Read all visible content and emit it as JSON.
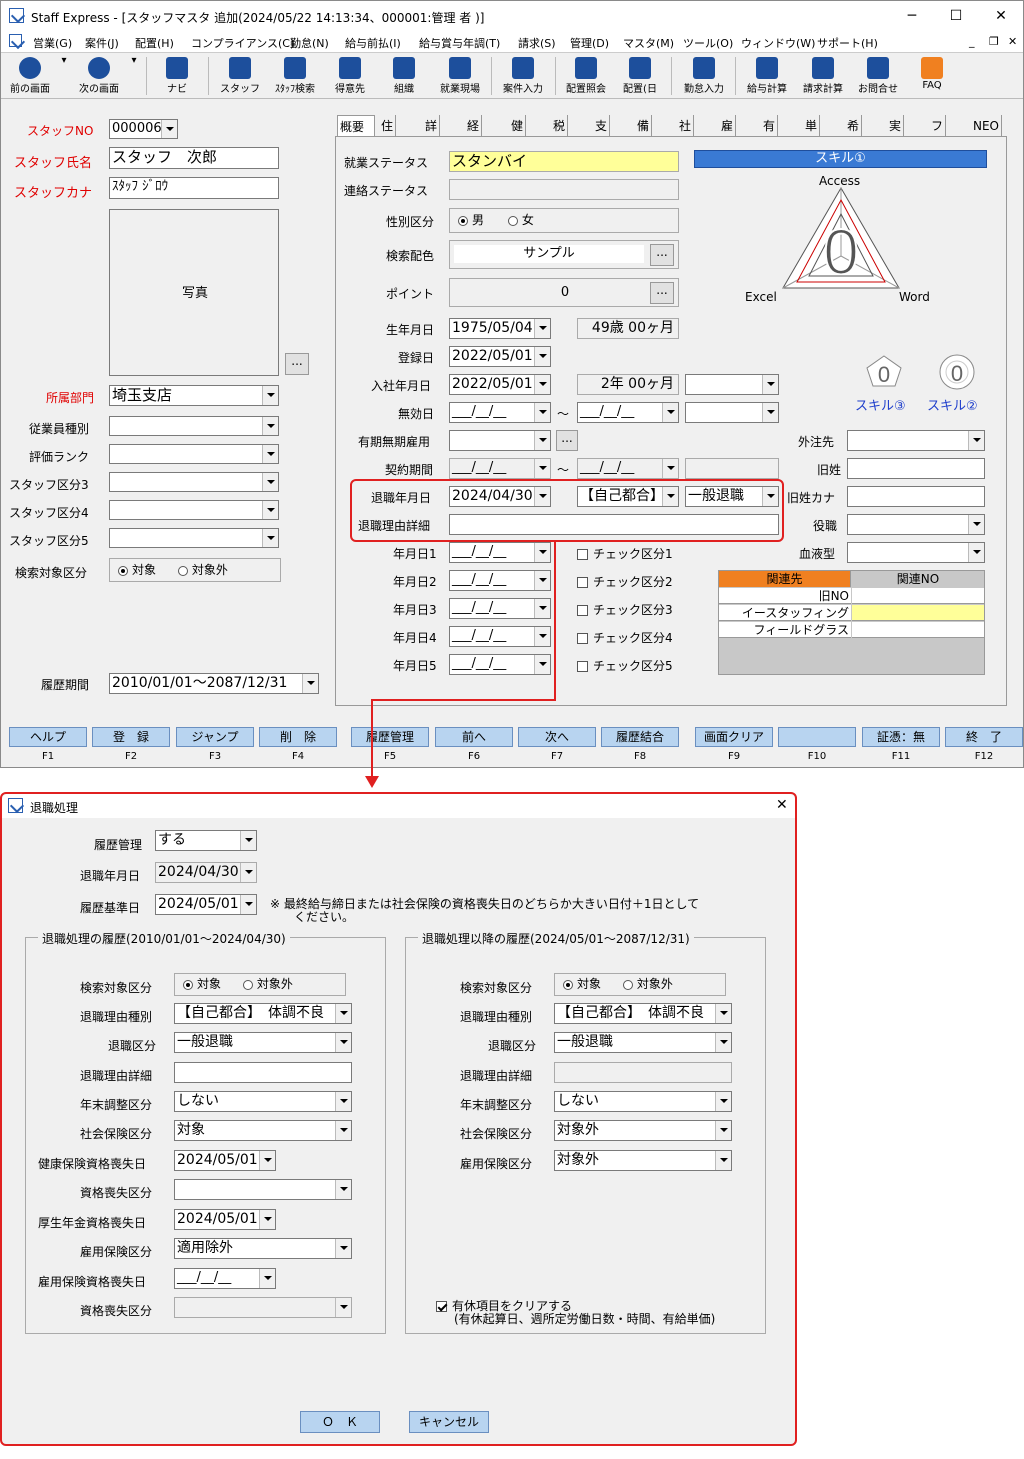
{
  "window": {
    "title": "Staff Express - [スタッフマスタ 追加(2024/05/22 14:13:34、000001:管理 者 )]"
  },
  "menu": [
    "営業(G)",
    "案件(J)",
    "配置(H)",
    "コンプライアンス(C)",
    "勤怠(N)",
    "給与前払(I)",
    "給与賞与年調(T)",
    "請求(S)",
    "管理(D)",
    "マスタ(M)",
    "ツール(O)",
    "ウィンドウ(W)",
    "サポート(H)"
  ],
  "toolbar": [
    "前の画面",
    "次の画面",
    "ナビ",
    "スタッフ",
    "ｽﾀｯﾌ検索",
    "得意先",
    "組織",
    "就業現場",
    "案件入力",
    "配置照会",
    "配置(日",
    "勤怠入力",
    "給与計算",
    "請求計算",
    "お問合せ",
    "FAQ"
  ],
  "left": {
    "staff_no_label": "スタッフNO",
    "staff_no": "000006",
    "name_label": "スタッフ氏名",
    "name": "スタッフ　次郎",
    "kana_label": "スタッフカナ",
    "kana": "ｽﾀｯﾌ ｼﾞﾛｳ",
    "photo": "写真",
    "ellipsis": "...",
    "dept_label": "所属部門",
    "dept": "埼玉支店",
    "f1": "従業員種別",
    "f2": "評価ランク",
    "f3": "スタッフ区分3",
    "f4": "スタッフ区分4",
    "f5": "スタッフ区分5",
    "search_label": "検索対象区分",
    "target": "対象",
    "nontarget": "対象外",
    "history_label": "履歴期間",
    "history": "2010/01/01～2087/12/31"
  },
  "tabs": [
    "概要",
    "住所",
    "詳細",
    "経歴",
    "健診",
    "税金",
    "支給",
    "備考",
    "社保",
    "雇保",
    "有休",
    "単価",
    "希望",
    "実績",
    "ファイル",
    "NEO"
  ],
  "main": {
    "status_label": "就業ステータス",
    "status": "スタンバイ",
    "contact_label": "連絡ステータス",
    "gender_label": "性別区分",
    "male": "男",
    "female": "女",
    "color_label": "検索配色",
    "color": "サンプル",
    "point_label": "ポイント",
    "point": "0",
    "birth_label": "生年月日",
    "birth": "1975/05/04",
    "age": "49歳 00ヶ月",
    "reg_label": "登録日",
    "reg": "2022/05/01",
    "join_label": "入社年月日",
    "join": "2022/05/01",
    "tenure": "2年 00ヶ月",
    "invalid_label": "無効日",
    "blank_date": "___/__/__",
    "tilde": "～",
    "term_label": "有期無期雇用",
    "contract_label": "契約期間",
    "retire_label": "退職年月日",
    "retire": "2024/04/30",
    "reason": "【自己都合】",
    "retire_kind": "一般退職",
    "retire_detail_label": "退職理由詳細",
    "ymd": [
      "年月日1",
      "年月日2",
      "年月日3",
      "年月日4",
      "年月日5"
    ],
    "checks": [
      "チェック区分1",
      "チェック区分2",
      "チェック区分3",
      "チェック区分4",
      "チェック区分5"
    ],
    "outside_label": "外注先",
    "oldname_label": "旧姓",
    "oldkana_label": "旧姓カナ",
    "post_label": "役職",
    "blood_label": "血液型"
  },
  "skill": {
    "title": "スキル①",
    "access": "Access",
    "excel": "Excel",
    "word": "Word",
    "zero": "0",
    "s3": "スキル③",
    "s2": "スキル②"
  },
  "related": {
    "h1": "関連先",
    "h2": "関連NO",
    "rows": [
      "旧NO",
      "イースタッフィング",
      "フィールドグラス"
    ]
  },
  "fkeys": [
    [
      "ヘルプ",
      "F1"
    ],
    [
      "登　録",
      "F2"
    ],
    [
      "ジャンプ",
      "F3"
    ],
    [
      "削　除",
      "F4"
    ],
    [
      "履歴管理",
      "F5"
    ],
    [
      "前へ",
      "F6"
    ],
    [
      "次へ",
      "F7"
    ],
    [
      "履歴結合",
      "F8"
    ],
    [
      "画面クリア",
      "F9"
    ],
    [
      "",
      "F10"
    ],
    [
      "証憑：無",
      "F11"
    ],
    [
      "終　了",
      "F12"
    ]
  ],
  "dialog": {
    "title": "退職処理",
    "hist_label": "履歴管理",
    "hist": "する",
    "retire_label": "退職年月日",
    "retire": "2024/04/30",
    "base_label": "履歴基準日",
    "base": "2024/05/01",
    "note": "※ 最終給与締日または社会保険の資格喪失日のどちらか大きい日付＋1日として\n　　ください。",
    "g1": "退職処理の履歴(2010/01/01～2024/04/30)",
    "g2": "退職処理以降の履歴(2024/05/01～2087/12/31)",
    "search": "検索対象区分",
    "target": "対象",
    "nontarget": "対象外",
    "reason_label": "退職理由種別",
    "reason": "【自己都合】　体調不良",
    "kind_label": "退職区分",
    "kind": "一般退職",
    "detail_label": "退職理由詳細",
    "ye_label": "年末調整区分",
    "ye": "しない",
    "si_label": "社会保険区分",
    "si": "対象",
    "si2": "対象外",
    "hi_loss_label": "健康保険資格喪失日",
    "hi_loss": "2024/05/01",
    "loss_kind_label": "資格喪失区分",
    "pension_loss_label": "厚生年金資格喪失日",
    "pension_loss": "2024/05/01",
    "ei_label": "雇用保険区分",
    "ei": "適用除外",
    "ei2": "対象外",
    "ei_loss_label": "雇用保険資格喪失日",
    "ei_loss": "___/__/__",
    "clear_label": "有休項目をクリアする",
    "clear_sub": "(有休起算日、週所定労働日数・時間、有給単価)",
    "ok": "Ｏ　Ｋ",
    "cancel": "キャンセル"
  }
}
